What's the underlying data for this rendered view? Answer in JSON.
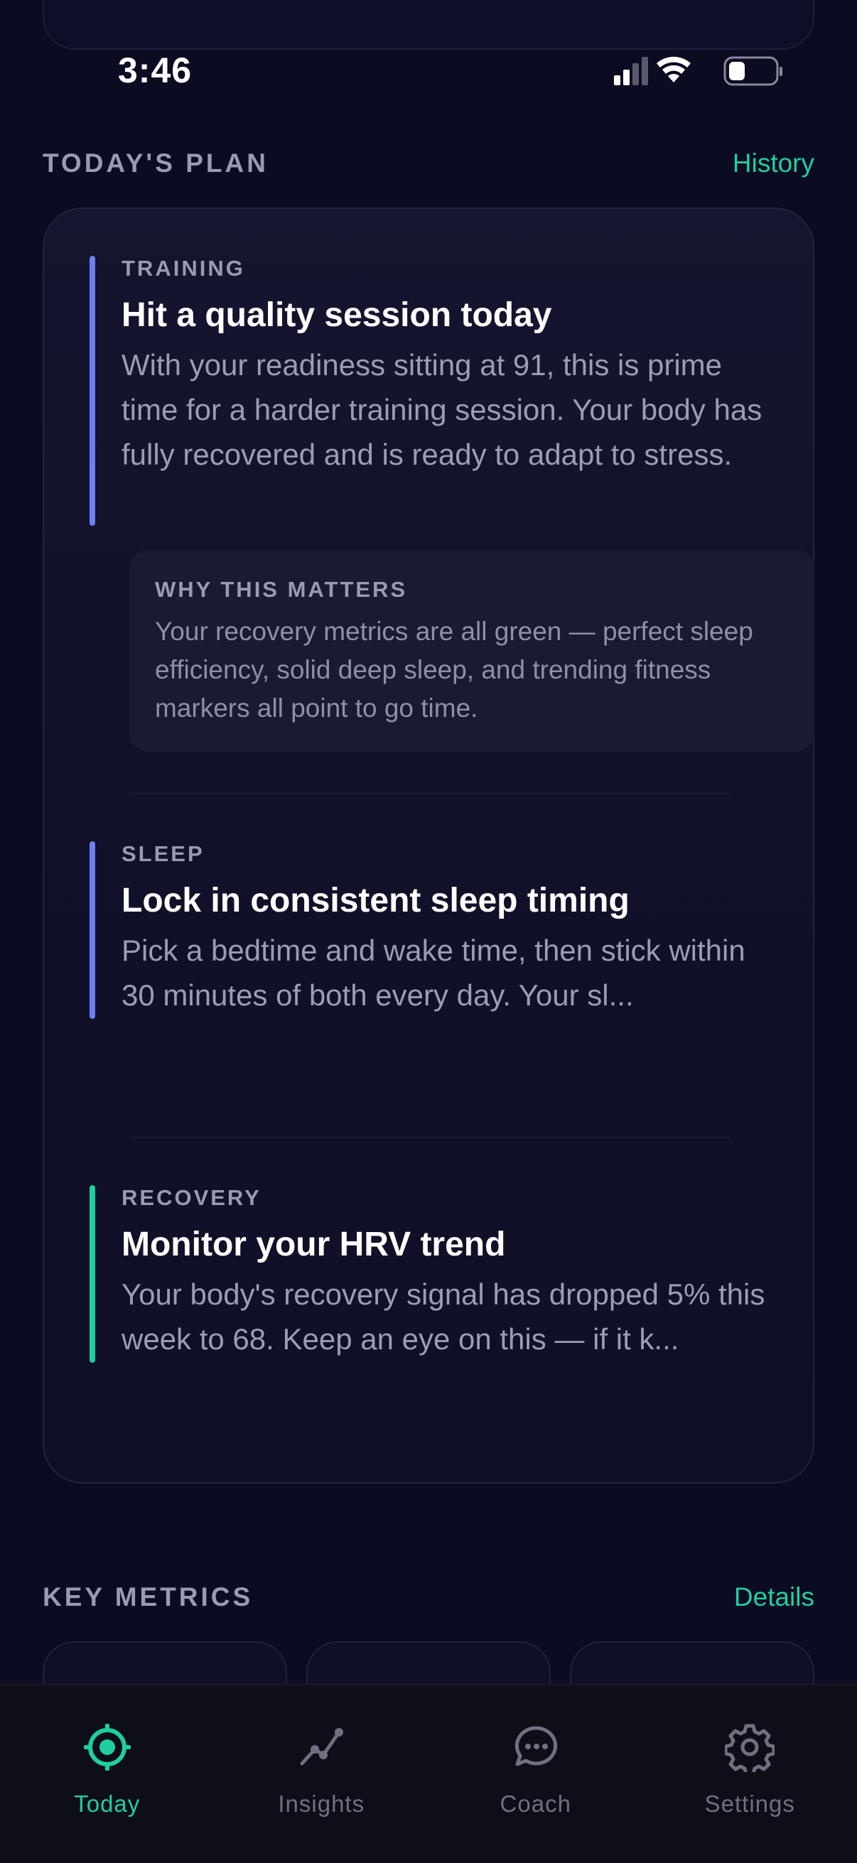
{
  "status_bar": {
    "time": "3:46"
  },
  "plan_section": {
    "title": "TODAY'S PLAN",
    "link": "History",
    "items": [
      {
        "category": "TRAINING",
        "title": "Hit a quality session today",
        "body": "With your readiness sitting at 91, this is prime time for a harder training session. Your body has fully recovered and is ready to adapt to stress.",
        "accent": "#6b7ff0",
        "why_title": "WHY THIS MATTERS",
        "why_body": "Your recovery metrics are all green — perfect sleep efficiency, solid deep sleep, and trending fitness markers all point to go time."
      },
      {
        "category": "SLEEP",
        "title": "Lock in consistent sleep timing",
        "body": "Pick a bedtime and wake time, then stick within 30 minutes of both every day. Your sl...",
        "accent": "#6b7ff0"
      },
      {
        "category": "RECOVERY",
        "title": "Monitor your HRV trend",
        "body": "Your body's recovery signal has dropped 5% this week to 68. Keep an eye on this — if it k...",
        "accent": "#1fcf9f"
      }
    ]
  },
  "metrics_section": {
    "title": "KEY METRICS",
    "link": "Details"
  },
  "tab_bar": {
    "tabs": [
      {
        "label": "Today",
        "icon": "target-icon",
        "active": true
      },
      {
        "label": "Insights",
        "icon": "trend-chart-icon",
        "active": false
      },
      {
        "label": "Coach",
        "icon": "chat-bubble-icon",
        "active": false
      },
      {
        "label": "Settings",
        "icon": "gear-icon",
        "active": false
      }
    ]
  },
  "colors": {
    "background": "#0b0b22",
    "accent_green": "#1fcf9f",
    "accent_blue": "#6b7ff0",
    "muted_text": "#9c9db2"
  }
}
